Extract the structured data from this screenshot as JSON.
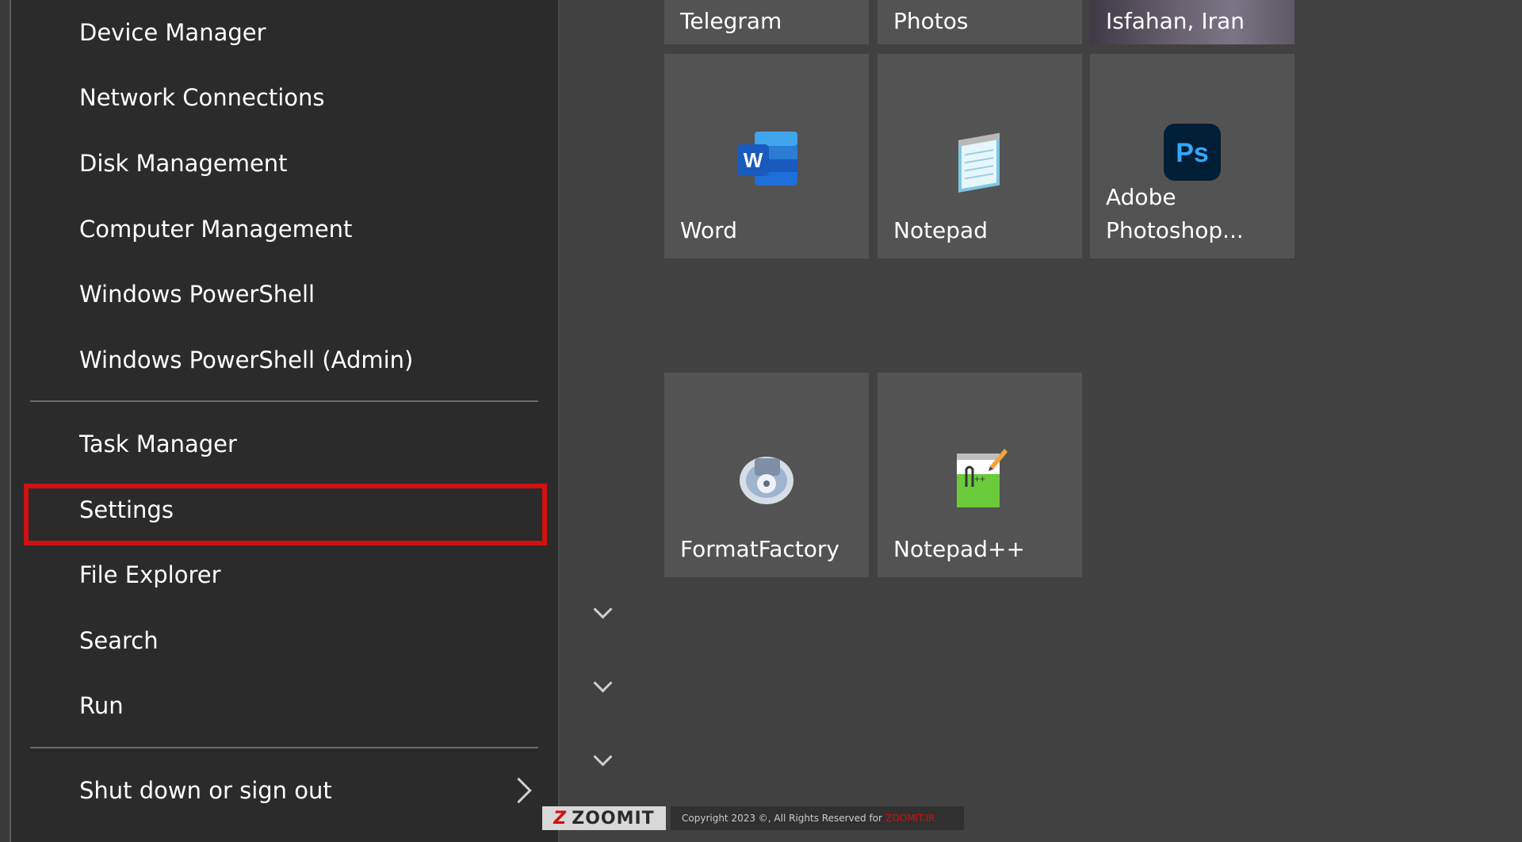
{
  "menu": {
    "items": [
      {
        "label": "Device Manager"
      },
      {
        "label": "Network Connections"
      },
      {
        "label": "Disk Management"
      },
      {
        "label": "Computer Management"
      },
      {
        "label": "Windows PowerShell"
      },
      {
        "label": "Windows PowerShell (Admin)"
      },
      {
        "label": "Task Manager"
      },
      {
        "label": "Settings"
      },
      {
        "label": "File Explorer"
      },
      {
        "label": "Search"
      },
      {
        "label": "Run"
      },
      {
        "label": "Shut down or sign out"
      }
    ],
    "highlight_color": "#cf1111"
  },
  "tiles": {
    "telegram": "Telegram",
    "photos": "Photos",
    "weather": "Isfahan, Iran",
    "word": "Word",
    "notepad": "Notepad",
    "photoshop": "Adobe\nPhotoshop...",
    "photoshop_icon_text": "Ps",
    "word_icon_text": "W",
    "formatfactory": "FormatFactory",
    "notepadpp": "Notepad++"
  },
  "watermark": {
    "brand": "ZOOMIT",
    "brand_mark": "Z",
    "copyright": "Copyright 2023 ©, All Rights Reserved for",
    "site": "ZOOMIT.IR"
  }
}
